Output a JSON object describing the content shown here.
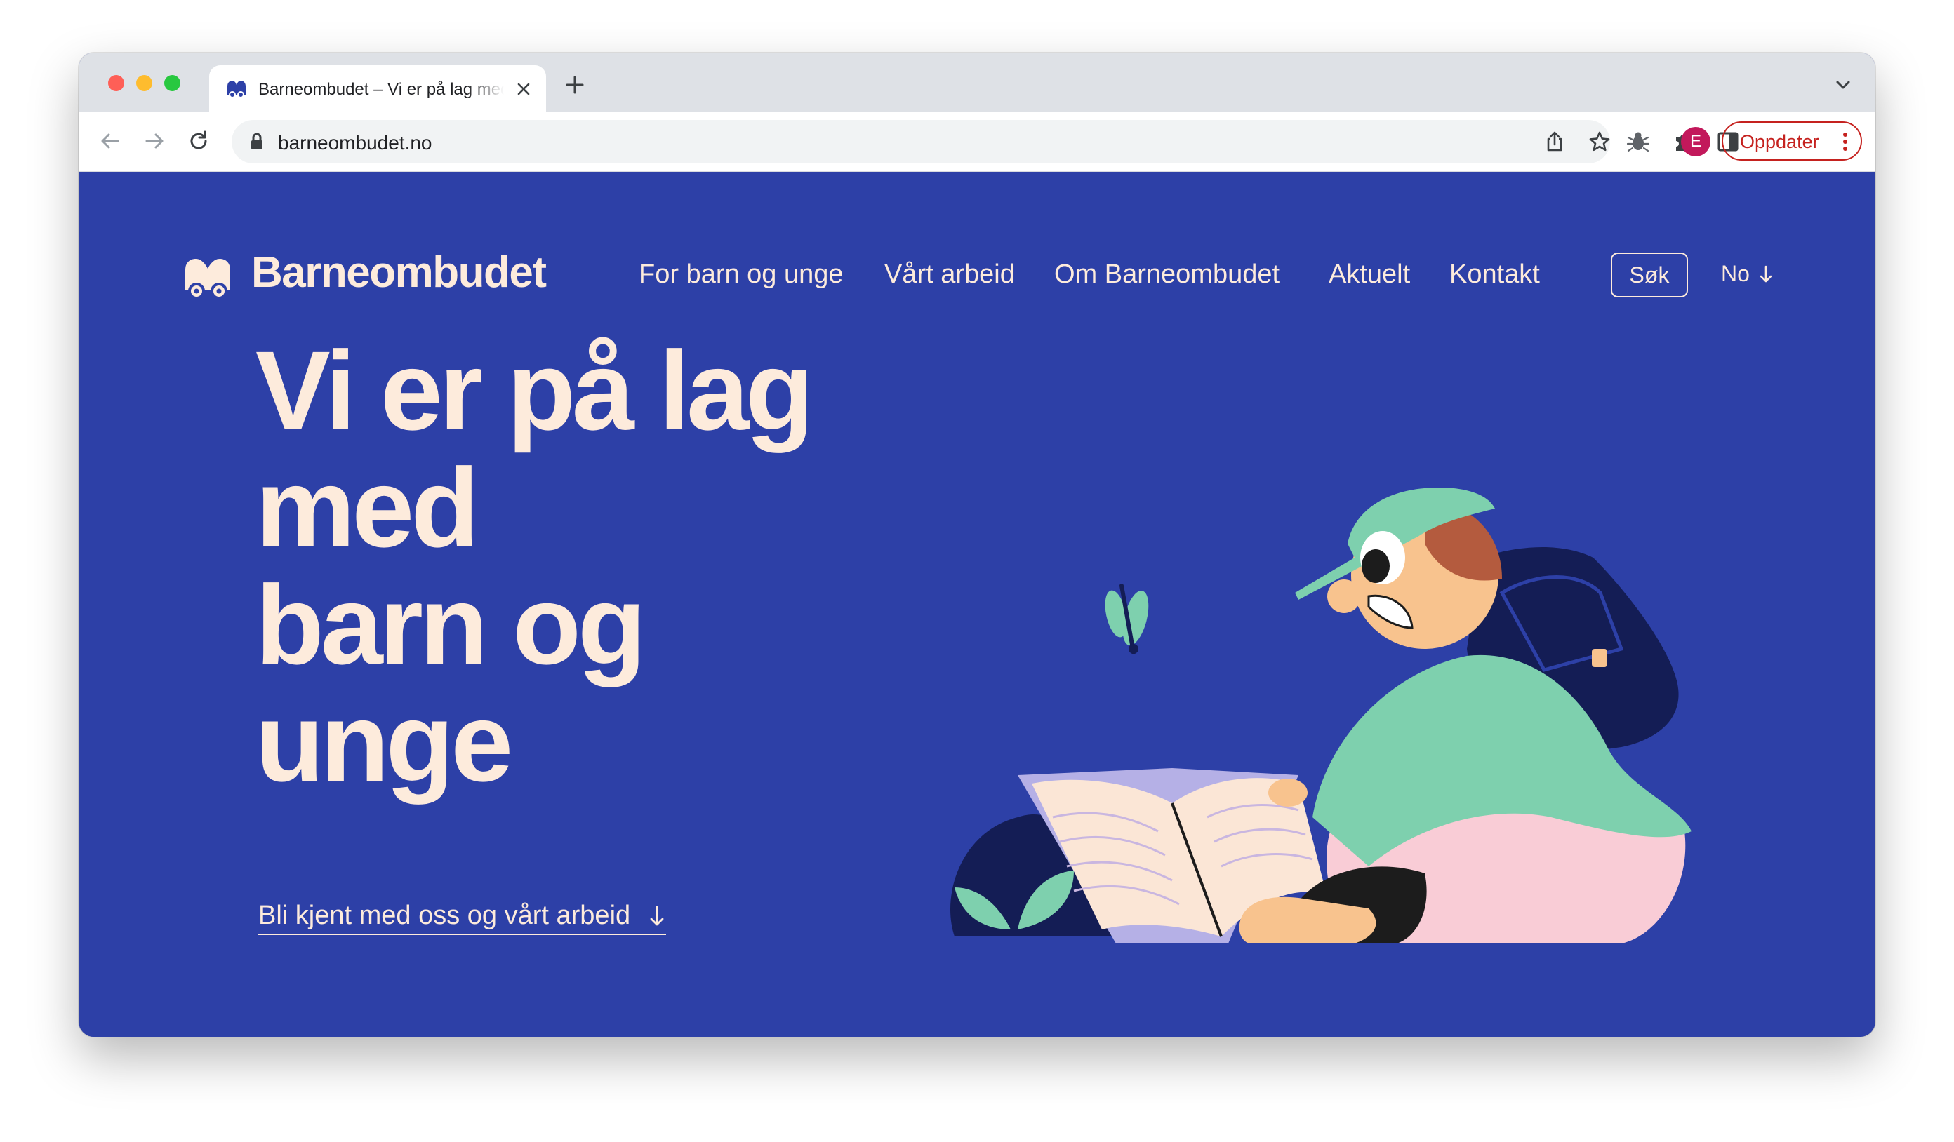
{
  "browser": {
    "tab": {
      "title": "Barneombudet – Vi er på lag med barn og unge"
    },
    "address_bar": {
      "url": "barneombudet.no"
    },
    "profile": {
      "initial": "E"
    },
    "update_button": {
      "label": "Oppdater"
    }
  },
  "site": {
    "brand": "Barneombudet",
    "nav": [
      {
        "label": "For barn og unge"
      },
      {
        "label": "Vårt arbeid"
      },
      {
        "label": "Om Barneombudet"
      },
      {
        "label": "Aktuelt"
      },
      {
        "label": "Kontakt"
      }
    ],
    "search_label": "Søk",
    "language_label": "No",
    "hero": {
      "lines": [
        "Vi er på lag",
        "med",
        "barn og",
        "unge"
      ]
    },
    "cta_label": "Bli kjent med oss og vårt arbeid"
  },
  "colors": {
    "page_background": "#2d40a7",
    "text": "#fdebdc",
    "update_red": "#c5221f",
    "avatar": "#c2185b"
  },
  "icons": [
    "back-arrow-icon",
    "forward-arrow-icon",
    "reload-icon",
    "lock-icon",
    "share-icon",
    "star-icon",
    "bug-extension-icon",
    "puzzle-extension-icon",
    "side-panel-icon",
    "more-vertical-icon",
    "arrow-down-icon"
  ]
}
